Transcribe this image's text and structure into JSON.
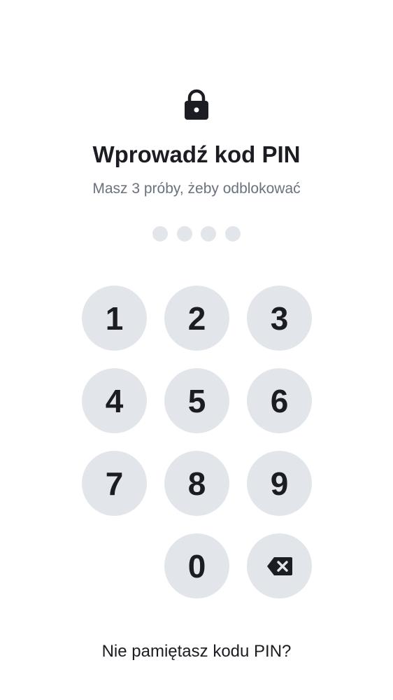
{
  "header": {
    "lock_icon": "lock-icon",
    "title": "Wprowadź kod PIN",
    "subtitle": "Masz 3 próby, żeby odblokować"
  },
  "pin": {
    "length": 4,
    "entered": 0
  },
  "keypad": {
    "keys": [
      "1",
      "2",
      "3",
      "4",
      "5",
      "6",
      "7",
      "8",
      "9",
      "0"
    ],
    "backspace_icon": "backspace-icon"
  },
  "footer": {
    "forgot_label": "Nie pamiętasz kodu PIN?"
  },
  "colors": {
    "text": "#1b1d22",
    "muted": "#69727d",
    "key_background": "#e2e6eb",
    "background": "#ffffff"
  }
}
